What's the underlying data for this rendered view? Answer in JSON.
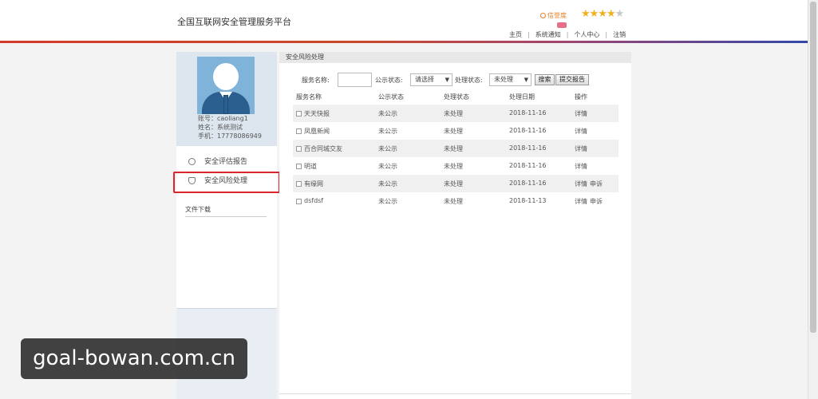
{
  "header": {
    "title": "全国互联网安全管理服务平台",
    "credit_label": "信誉度",
    "stars_filled": 4,
    "stars_total": 5,
    "nav": [
      "主页",
      "系统通知",
      "个人中心",
      "注销"
    ]
  },
  "sidebar": {
    "account_label": "账号：caoliang1",
    "name_label": "姓名：系统测试",
    "phone_label": "手机：17778086949",
    "menu": [
      {
        "label": "安全评估报告",
        "icon": "search-icon"
      },
      {
        "label": "安全风险处理",
        "icon": "shield-icon"
      }
    ],
    "download_title": "文件下载"
  },
  "main": {
    "tab_title": "安全风险处理",
    "filter": {
      "service_name_label": "服务名称:",
      "publish_status_label": "公示状态:",
      "publish_status_value": "请选择",
      "process_status_label": "处理状态:",
      "process_status_value": "未处理",
      "search_button": "搜索",
      "submit_report_button": "提交报告"
    },
    "table": {
      "headers": [
        "服务名称",
        "公示状态",
        "处理状态",
        "处理日期",
        "操作"
      ],
      "rows": [
        {
          "name": "天天快报",
          "publish": "未公示",
          "process": "未处理",
          "date": "2018-11-16",
          "detail": "详情",
          "appeal": ""
        },
        {
          "name": "凤凰新闻",
          "publish": "未公示",
          "process": "未处理",
          "date": "2018-11-16",
          "detail": "详情",
          "appeal": ""
        },
        {
          "name": "百合同城交友",
          "publish": "未公示",
          "process": "未处理",
          "date": "2018-11-16",
          "detail": "详情",
          "appeal": ""
        },
        {
          "name": "明道",
          "publish": "未公示",
          "process": "未处理",
          "date": "2018-11-16",
          "detail": "详情",
          "appeal": ""
        },
        {
          "name": "有缘网",
          "publish": "未公示",
          "process": "未处理",
          "date": "2018-11-16",
          "detail": "详情",
          "appeal": "申诉"
        },
        {
          "name": "dsfdsf",
          "publish": "未公示",
          "process": "未处理",
          "date": "2018-11-13",
          "detail": "详情",
          "appeal": "申诉"
        }
      ]
    }
  },
  "watermark": "goal-bowan.com.cn",
  "colors": {
    "highlight": "#d9262b",
    "accent_red": "#d13b2c",
    "accent_blue": "#3248a8",
    "star": "#f1b020"
  }
}
